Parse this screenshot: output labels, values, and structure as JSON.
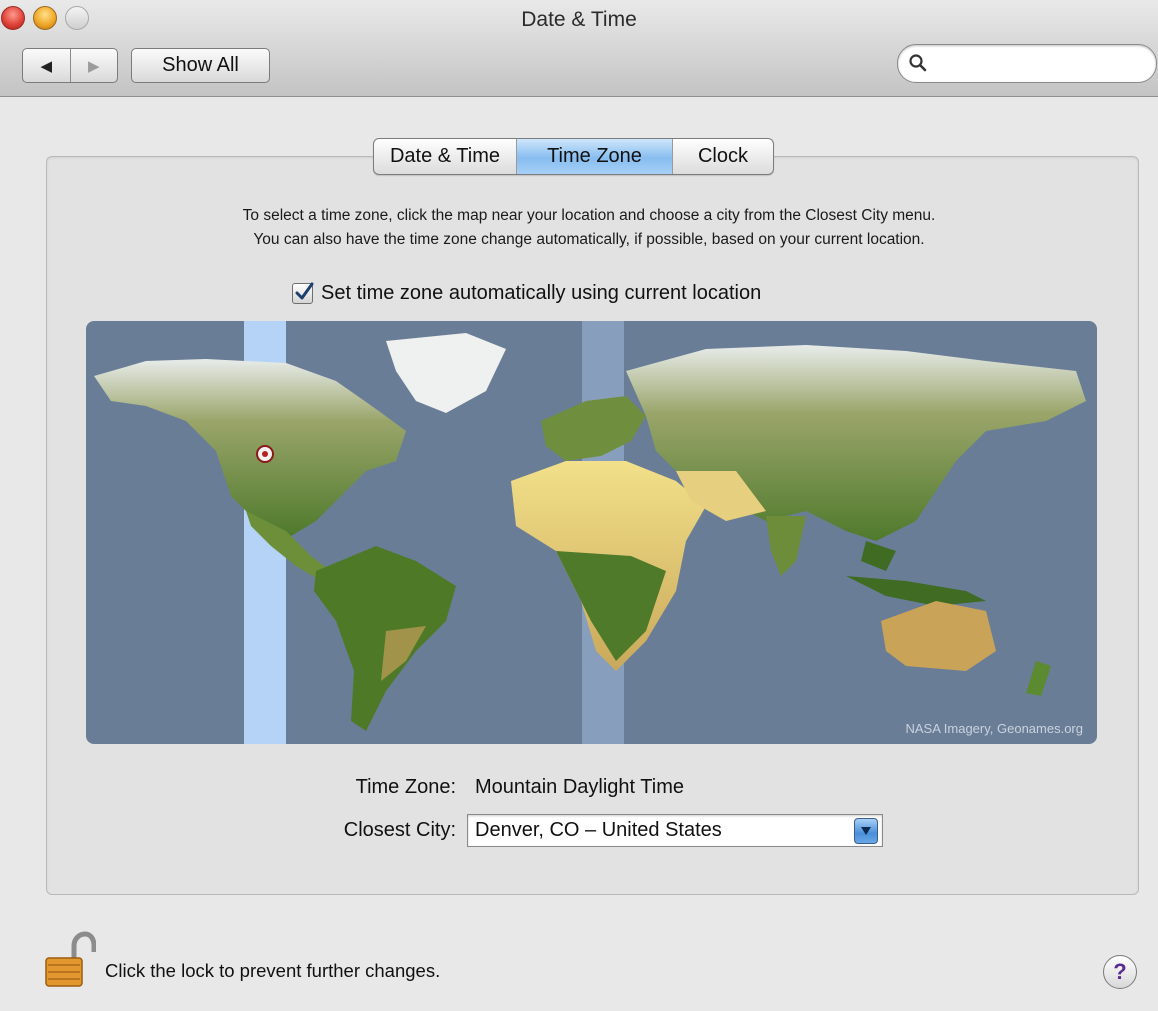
{
  "window": {
    "title": "Date & Time"
  },
  "toolbar": {
    "back_icon": "back-arrow-icon",
    "forward_icon": "forward-arrow-icon",
    "back_glyph": "◀",
    "forward_glyph": "▶",
    "show_all_label": "Show All",
    "search": {
      "value": "",
      "placeholder": ""
    }
  },
  "tabs": [
    {
      "label": "Date & Time",
      "active": false
    },
    {
      "label": "Time Zone",
      "active": true
    },
    {
      "label": "Clock",
      "active": false
    }
  ],
  "time_zone_pane": {
    "instructions_line1": "To select a time zone, click the map near your location and choose a city from the Closest City menu.",
    "instructions_line2": "You can also have the time zone change automatically, if possible, based on your current location.",
    "auto_checkbox": {
      "label": "Set time zone automatically using current location",
      "checked": true
    },
    "map_credit": "NASA Imagery, Geonames.org",
    "time_zone_label": "Time Zone:",
    "time_zone_value": "Mountain Daylight Time",
    "closest_city_label": "Closest City:",
    "closest_city_value": "Denver, CO – United States"
  },
  "footer": {
    "lock_text": "Click the lock to prevent further changes.",
    "help_glyph": "?"
  },
  "colors": {
    "active_tab": "#87bdf0",
    "ocean": "#6a7d97",
    "time_zone_band": "#b9d8fb"
  }
}
